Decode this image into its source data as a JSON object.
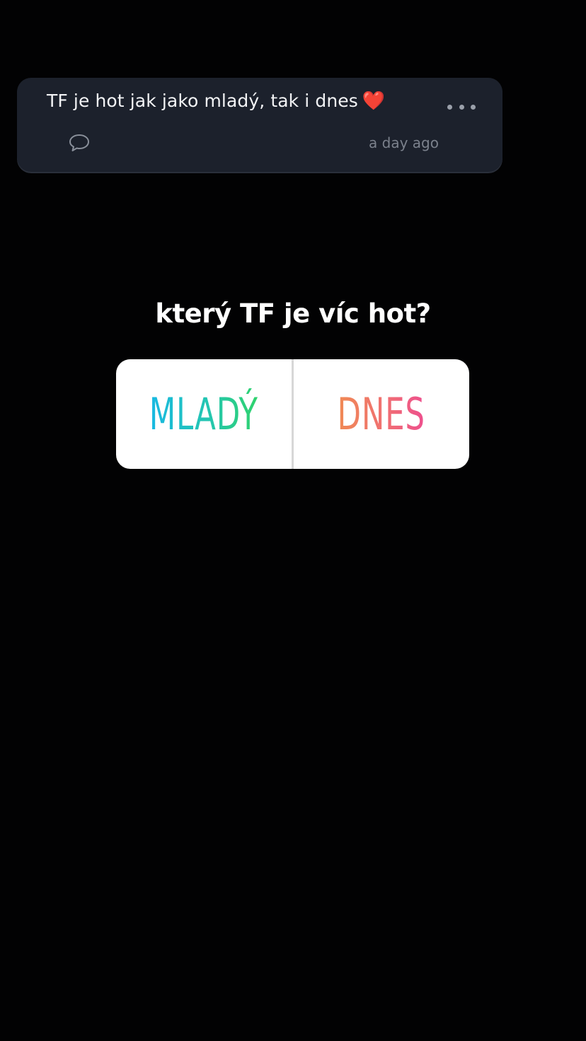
{
  "comment": {
    "text": "TF je hot jak jako mladý, tak i dnes",
    "emoji": "❤️",
    "timestamp": "a day ago",
    "icons": {
      "reply": "speech-bubble-icon",
      "more": "more-dots-icon"
    }
  },
  "poll": {
    "question": "který TF je víc hot?",
    "options": [
      {
        "label": "MLADÝ",
        "gradient": [
          "#18b8e3",
          "#2fd36c"
        ]
      },
      {
        "label": "DNES",
        "gradient": [
          "#f08a54",
          "#ee4f8e"
        ]
      }
    ]
  },
  "colors": {
    "background": "#020203",
    "card": "#1c212c",
    "poll_box": "#ffffff"
  }
}
